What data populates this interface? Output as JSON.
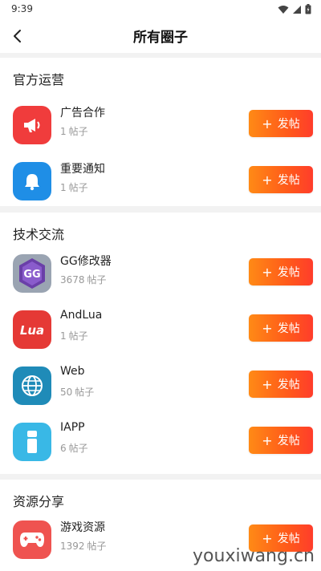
{
  "status": {
    "time": "9:39"
  },
  "header": {
    "title": "所有圈子"
  },
  "sections": [
    {
      "title": "官方运营",
      "items": [
        {
          "name": "广告合作",
          "count": "1",
          "unit": "帖子",
          "button": "发帖",
          "icon": "megaphone-icon",
          "color": "#f03c3c"
        },
        {
          "name": "重要通知",
          "count": "1",
          "unit": "帖子",
          "button": "发帖",
          "icon": "bell-icon",
          "color": "#1f8ee6"
        }
      ]
    },
    {
      "title": "技术交流",
      "items": [
        {
          "name": "GG修改器",
          "count": "3678",
          "unit": "帖子",
          "button": "发帖",
          "icon": "gg-logo-icon",
          "color": "#7a4fb6"
        },
        {
          "name": "AndLua",
          "count": "1",
          "unit": "帖子",
          "button": "发帖",
          "icon": "lua-logo-icon",
          "color": "#e53935"
        },
        {
          "name": "Web",
          "count": "50",
          "unit": "帖子",
          "button": "发帖",
          "icon": "globe-icon",
          "color": "#1f8bb8"
        },
        {
          "name": "IAPP",
          "count": "6",
          "unit": "帖子",
          "button": "发帖",
          "icon": "info-i-icon",
          "color": "#39b8e6"
        }
      ]
    },
    {
      "title": "资源分享",
      "items": [
        {
          "name": "游戏资源",
          "count": "1392",
          "unit": "帖子",
          "button": "发帖",
          "icon": "gamepad-icon",
          "color": "#ef5350"
        }
      ]
    }
  ],
  "watermark": "youxiwang.cn"
}
